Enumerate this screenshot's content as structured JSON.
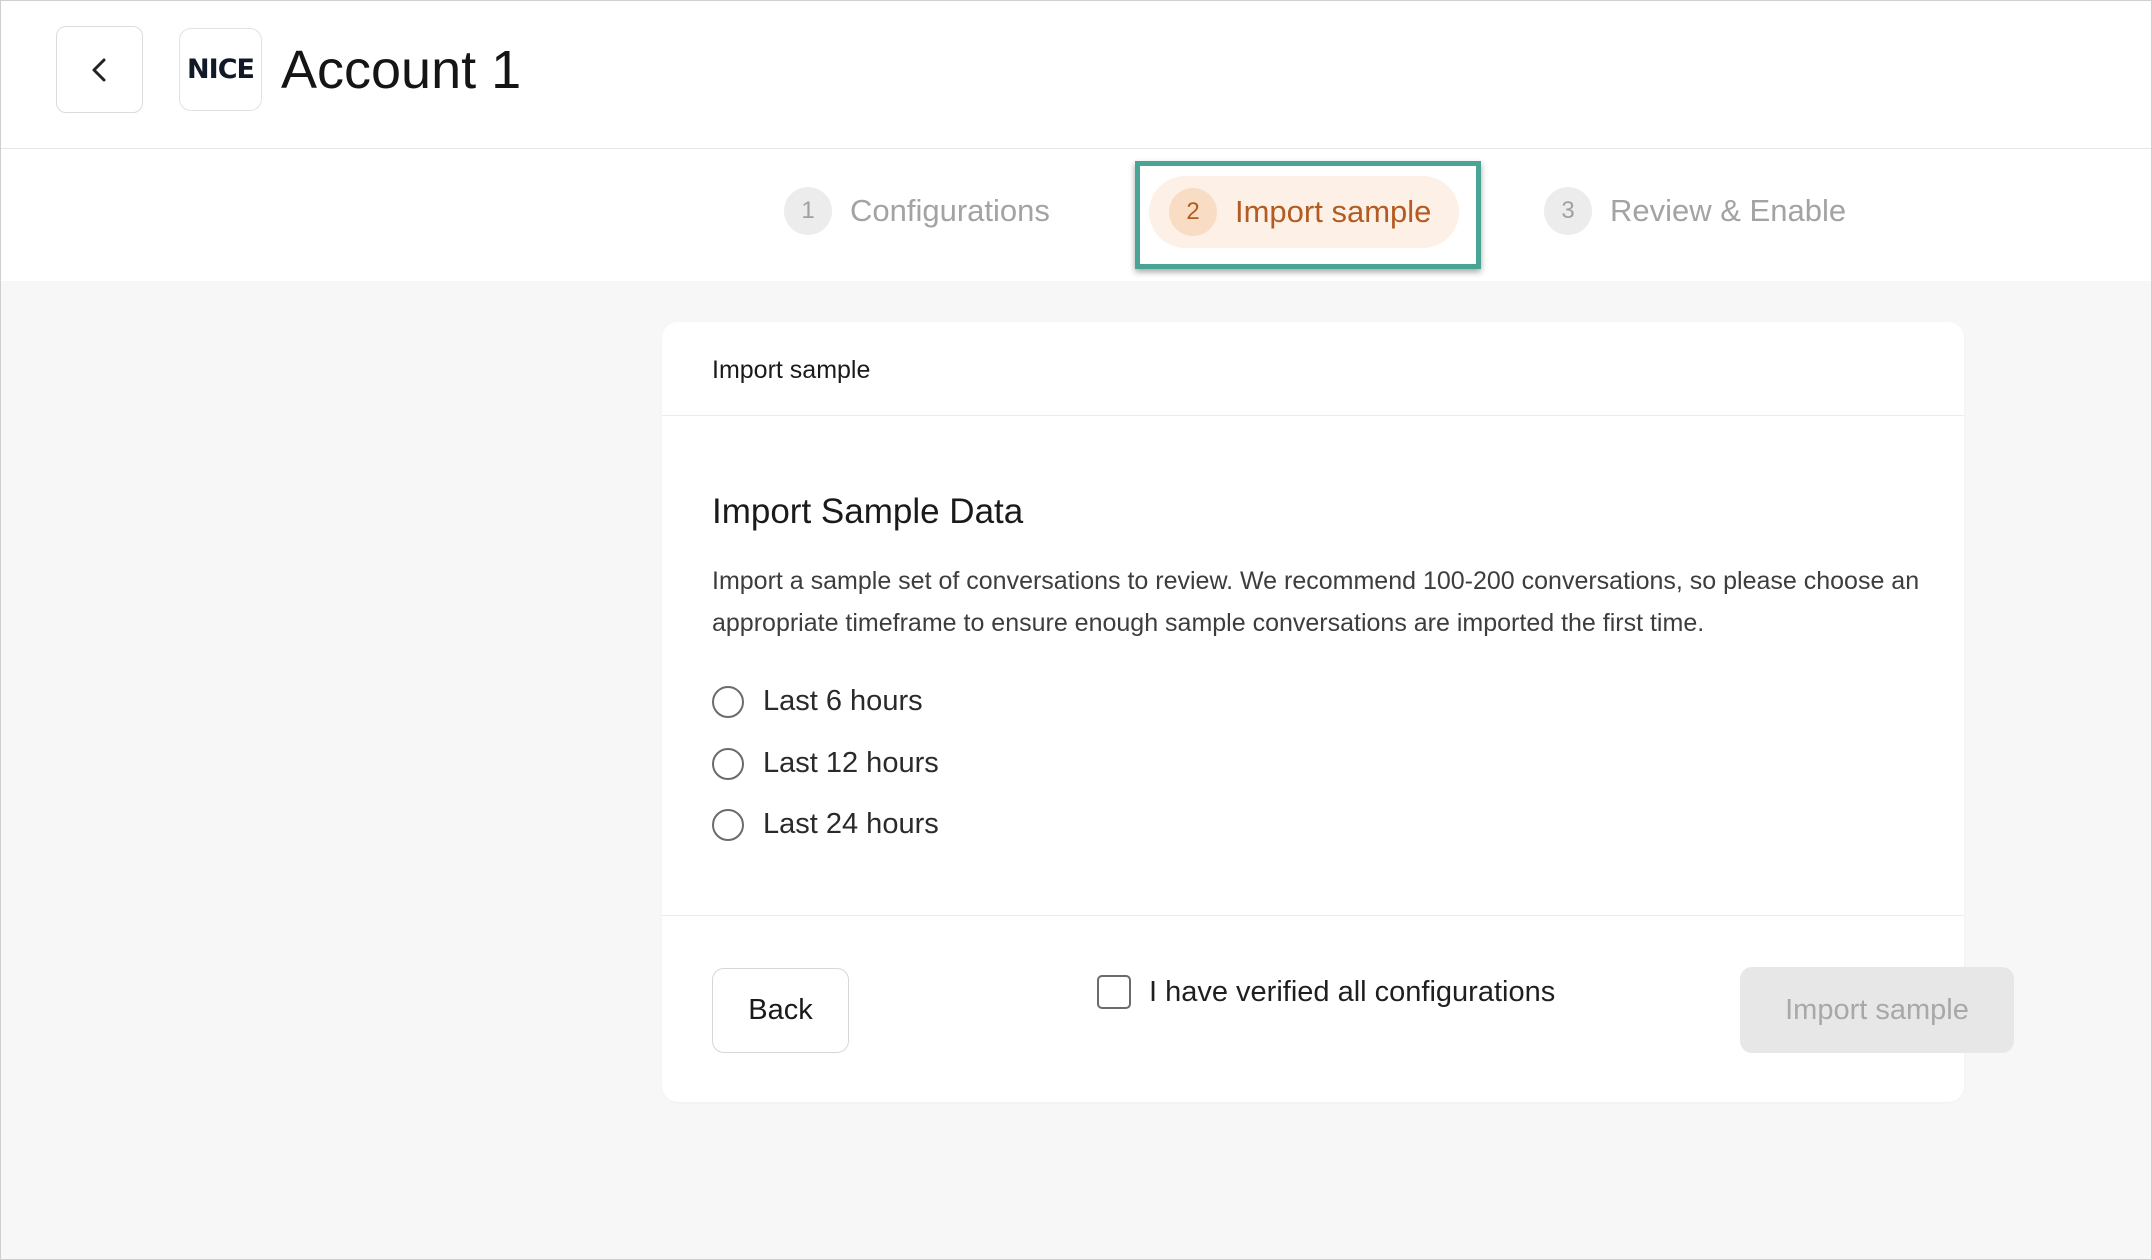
{
  "header": {
    "title": "Account 1",
    "logo_text": "NICE",
    "back_icon": "chevron-left-icon"
  },
  "stepper": {
    "steps": [
      {
        "number": "1",
        "label": "Configurations",
        "state": "inactive"
      },
      {
        "number": "2",
        "label": "Import sample",
        "state": "active"
      },
      {
        "number": "3",
        "label": "Review & Enable",
        "state": "inactive"
      }
    ],
    "highlight_color": "#4aa496",
    "active_color": "#b45b23"
  },
  "card": {
    "header_title": "Import sample",
    "section_title": "Import Sample Data",
    "description": "Import a sample set of conversations to review. We recommend 100-200 conversations, so please choose an appropriate timeframe to ensure enough sample conversations are imported the first time.",
    "options": [
      {
        "label": "Last 6 hours",
        "selected": false
      },
      {
        "label": "Last 12 hours",
        "selected": false
      },
      {
        "label": "Last 24 hours",
        "selected": false
      }
    ]
  },
  "footer": {
    "back_label": "Back",
    "verify_label": "I have verified all configurations",
    "verify_checked": false,
    "import_label": "Import sample",
    "import_disabled": true
  }
}
